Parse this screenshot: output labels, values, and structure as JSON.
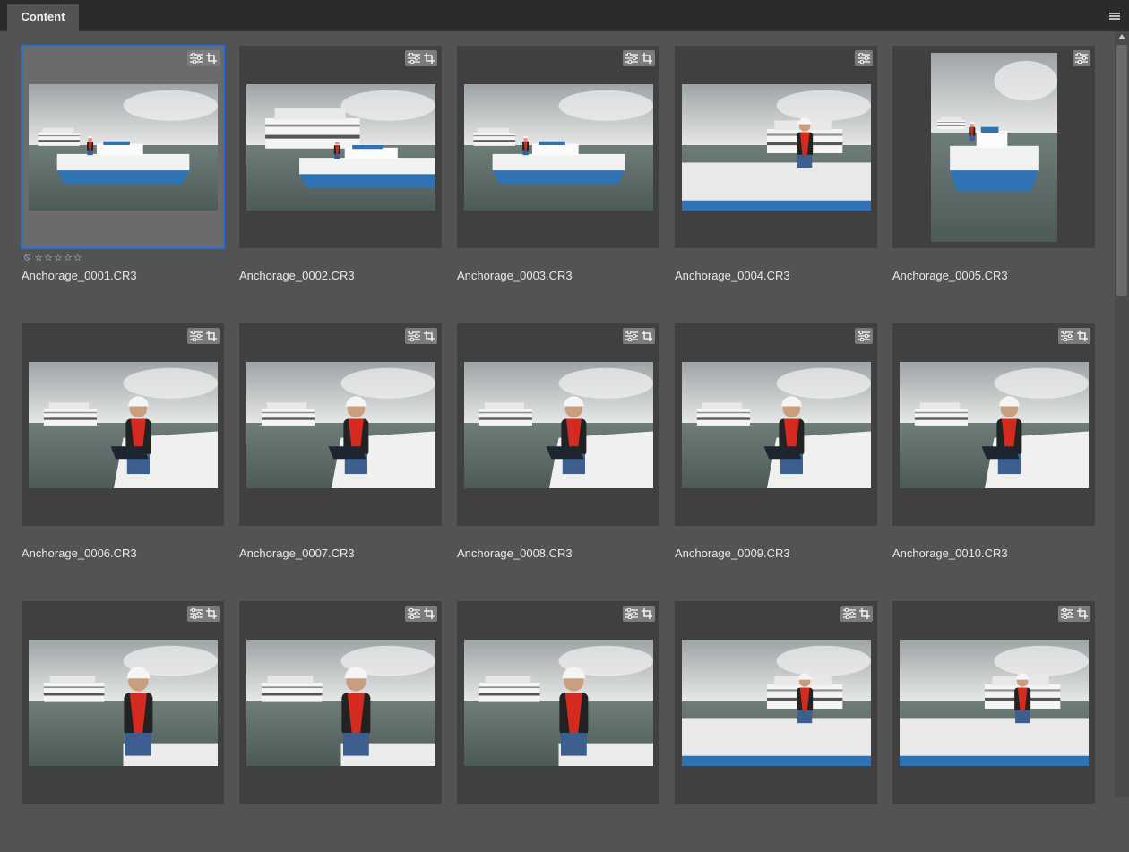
{
  "panel": {
    "tab_label": "Content",
    "menu_icon": "hamburger-menu-icon"
  },
  "selected_index": 0,
  "rating": {
    "reject_symbol": "⃠",
    "star_symbol": "☆",
    "stars": 5
  },
  "items": [
    {
      "filename": "Anchorage_0001.CR3",
      "badges": [
        "adjust",
        "crop"
      ],
      "orientation": "landscape",
      "scene": "boat"
    },
    {
      "filename": "Anchorage_0002.CR3",
      "badges": [
        "adjust",
        "crop"
      ],
      "orientation": "landscape",
      "scene": "boat-close"
    },
    {
      "filename": "Anchorage_0003.CR3",
      "badges": [
        "adjust",
        "crop"
      ],
      "orientation": "landscape",
      "scene": "boat"
    },
    {
      "filename": "Anchorage_0004.CR3",
      "badges": [
        "adjust"
      ],
      "orientation": "landscape",
      "scene": "deck"
    },
    {
      "filename": "Anchorage_0005.CR3",
      "badges": [
        "adjust"
      ],
      "orientation": "portrait",
      "scene": "boat"
    },
    {
      "filename": "Anchorage_0006.CR3",
      "badges": [
        "adjust",
        "crop"
      ],
      "orientation": "landscape",
      "scene": "laptop"
    },
    {
      "filename": "Anchorage_0007.CR3",
      "badges": [
        "adjust",
        "crop"
      ],
      "orientation": "landscape",
      "scene": "laptop"
    },
    {
      "filename": "Anchorage_0008.CR3",
      "badges": [
        "adjust",
        "crop"
      ],
      "orientation": "landscape",
      "scene": "phone-laptop"
    },
    {
      "filename": "Anchorage_0009.CR3",
      "badges": [
        "adjust"
      ],
      "orientation": "landscape",
      "scene": "phone-laptop"
    },
    {
      "filename": "Anchorage_0010.CR3",
      "badges": [
        "adjust",
        "crop"
      ],
      "orientation": "landscape",
      "scene": "phone-laptop"
    },
    {
      "filename": "",
      "badges": [
        "adjust",
        "crop"
      ],
      "orientation": "landscape",
      "scene": "standing-phone"
    },
    {
      "filename": "",
      "badges": [
        "adjust",
        "crop"
      ],
      "orientation": "landscape",
      "scene": "standing-phone"
    },
    {
      "filename": "",
      "badges": [
        "adjust",
        "crop"
      ],
      "orientation": "landscape",
      "scene": "tablet"
    },
    {
      "filename": "",
      "badges": [
        "adjust",
        "crop"
      ],
      "orientation": "landscape",
      "scene": "deck-man"
    },
    {
      "filename": "",
      "badges": [
        "adjust",
        "crop"
      ],
      "orientation": "landscape",
      "scene": "deck-man"
    }
  ],
  "colors": {
    "selection": "#2a6fd6",
    "life_vest": "#d42a1f",
    "hull": "#2f73b5"
  }
}
